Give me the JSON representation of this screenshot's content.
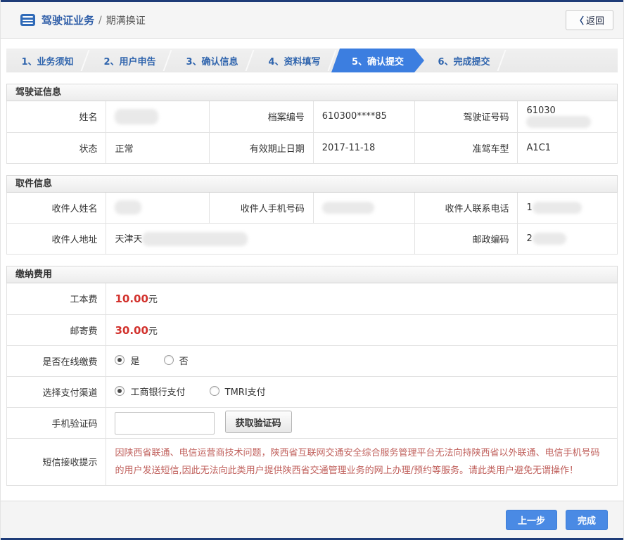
{
  "header": {
    "title": "驾驶证业务",
    "separator": "/",
    "subtitle": "期满换证",
    "back_chevron": "〈",
    "back_label": "返回"
  },
  "steps": {
    "items": [
      {
        "label": "1、业务须知",
        "active": false
      },
      {
        "label": "2、用户申告",
        "active": false
      },
      {
        "label": "3、确认信息",
        "active": false
      },
      {
        "label": "4、资料填写",
        "active": false
      },
      {
        "label": "5、确认提交",
        "active": true
      },
      {
        "label": "6、完成提交",
        "active": false
      }
    ]
  },
  "license": {
    "title": "驾驶证信息",
    "name_label": "姓名",
    "name_value": "",
    "file_no_label": "档案编号",
    "file_no_value": "610300****85",
    "license_no_label": "驾驶证号码",
    "license_no_value_visible": "61030",
    "status_label": "状态",
    "status_value": "正常",
    "expiry_label": "有效期止日期",
    "expiry_value": "2017-11-18",
    "vehicle_label": "准驾车型",
    "vehicle_value": "A1C1"
  },
  "pickup": {
    "title": "取件信息",
    "recipient_name_label": "收件人姓名",
    "recipient_name_value": "",
    "recipient_mobile_label": "收件人手机号码",
    "recipient_mobile_value": "",
    "recipient_phone_label": "收件人联系电话",
    "recipient_phone_value_visible": "1",
    "recipient_address_label": "收件人地址",
    "recipient_address_value_visible": "天津天",
    "postal_code_label": "邮政编码",
    "postal_code_value_visible": "2"
  },
  "fees": {
    "title": "缴纳费用",
    "cost_label": "工本费",
    "cost_value": "10.00",
    "cost_unit": "元",
    "postage_label": "邮寄费",
    "postage_value": "30.00",
    "postage_unit": "元",
    "online_pay_label": "是否在线缴费",
    "online_yes": "是",
    "online_no": "否",
    "online_selected": "是",
    "channel_label": "选择支付渠道",
    "channel_icbc": "工商银行支付",
    "channel_tmri": "TMRI支付",
    "channel_selected": "工商银行支付",
    "sms_code_label": "手机验证码",
    "sms_code_value": "",
    "get_code_button": "获取验证码",
    "sms_tip_label": "短信接收提示",
    "sms_tip_text": "因陕西省联通、电信运营商技术问题，陕西省互联网交通安全综合服务管理平台无法向持陕西省以外联通、电信手机号码的用户发送短信,因此无法向此类用户提供陕西省交通管理业务的网上办理/预约等服务。请此类用户避免无谓操作！"
  },
  "footer": {
    "prev_label": "上一步",
    "finish_label": "完成"
  },
  "colors": {
    "top_bar_navy": "#1e3c78",
    "active_tab_blue": "#3c7ee0",
    "link_blue": "#2f64ad",
    "fee_red": "#d2322d",
    "tip_red": "#c0605c"
  }
}
